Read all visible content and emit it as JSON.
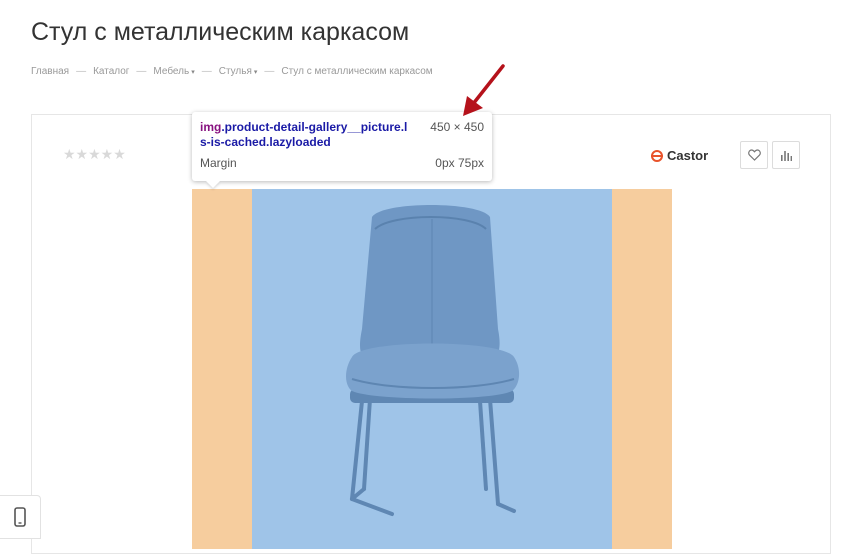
{
  "page": {
    "title": "Стул с металлическим каркасом"
  },
  "breadcrumb": [
    {
      "label": "Главная",
      "has_dropdown": false
    },
    {
      "label": "Каталог",
      "has_dropdown": false
    },
    {
      "label": "Мебель",
      "has_dropdown": true
    },
    {
      "label": "Стулья",
      "has_dropdown": true
    },
    {
      "label": "Стул с металлическим каркасом",
      "has_dropdown": false
    }
  ],
  "breadcrumb_separator": "—",
  "breadcrumb_caret": "▾",
  "product": {
    "rating_stars": "★★★★★",
    "rating": 0,
    "rating_max": 5,
    "brand_name": "Castor",
    "brand_color": "#e8532b",
    "icons": {
      "favorite": "heart-icon",
      "compare": "bar-chart-icon",
      "mobile": "mobile-phone-icon"
    }
  },
  "inspector_tooltip": {
    "tag": "img",
    "classes": ".product-detail-gallery__picture.ls-is-cached.lazyloaded",
    "size": "450 × 450",
    "property_label": "Margin",
    "property_value": "0px 75px"
  },
  "colors": {
    "margin_overlay": "#f6cd9e",
    "content_overlay": "#9fc4e8",
    "annotation_arrow": "#b5121b",
    "selector_tag": "#881280",
    "selector_class": "#1a1aa6"
  }
}
